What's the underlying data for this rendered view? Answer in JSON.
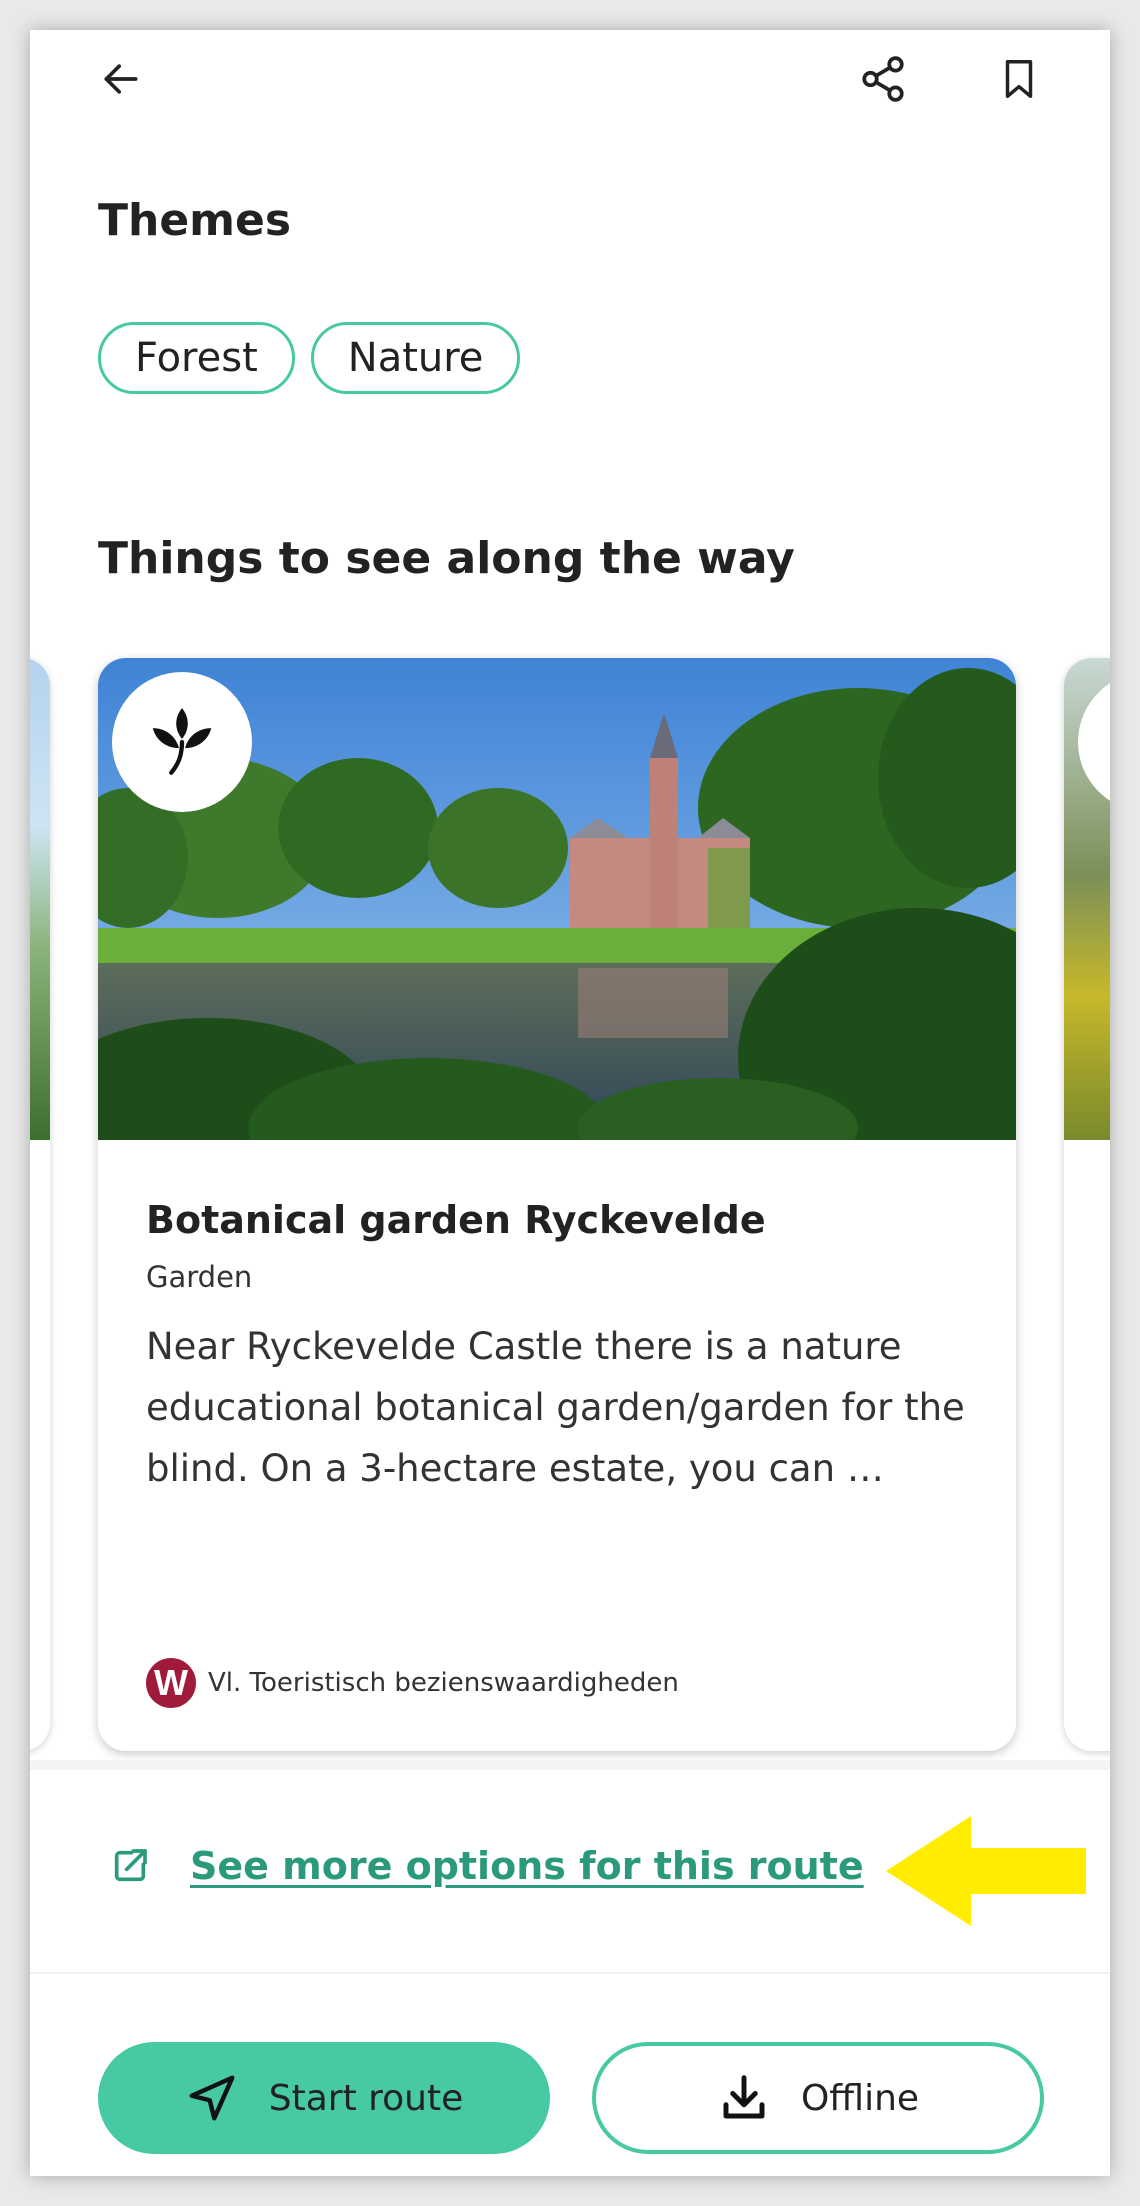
{
  "header": {
    "back_icon": "arrow-left-icon",
    "share_icon": "share-icon",
    "bookmark_icon": "bookmark-icon"
  },
  "themes": {
    "title": "Themes",
    "chips": [
      "Forest",
      "Nature"
    ]
  },
  "sights": {
    "title": "Things to see along the way",
    "card": {
      "badge_icon": "leaf-icon",
      "title": "Botanical garden Ryckevelde",
      "category": "Garden",
      "description": "Near Ryckevelde Castle there is a nature educational botanical garden/garden for the blind. On a 3-hectare estate, you can …",
      "source_logo": "W",
      "source": "Vl. Toeristisch bezienswaardigheden"
    }
  },
  "more_link": {
    "label": "See more options for this route",
    "icon": "external-link-icon"
  },
  "actions": {
    "start_label": "Start route",
    "start_icon": "navigation-arrow-icon",
    "offline_label": "Offline",
    "offline_icon": "download-icon"
  },
  "colors": {
    "accent": "#47c9a3",
    "link": "#2b9a7c",
    "annotation": "#ffec00"
  }
}
